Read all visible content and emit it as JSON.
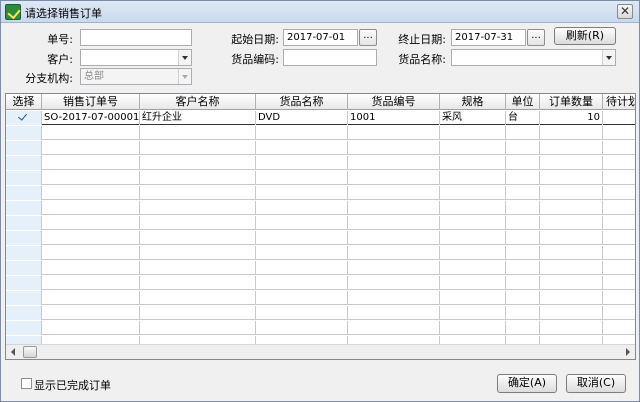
{
  "window": {
    "title": "请选择销售订单",
    "close_symbol": "✕"
  },
  "filters": {
    "order_no_label": "单号:",
    "order_no_value": "",
    "start_date_label": "起始日期:",
    "start_date_value": "2017-07-01",
    "end_date_label": "终止日期:",
    "end_date_value": "2017-07-31",
    "refresh_label": "刷新(R)",
    "customer_label": "客户:",
    "customer_value": "",
    "goods_code_label": "货品编码:",
    "goods_code_value": "",
    "goods_name_label": "货品名称:",
    "goods_name_value": "",
    "branch_label": "分支机构:",
    "branch_value": "总部",
    "dots": "..."
  },
  "grid": {
    "columns": [
      "选择",
      "销售订单号",
      "客户名称",
      "货品名称",
      "货品编号",
      "规格",
      "单位",
      "订单数量",
      "待计划"
    ],
    "rows": [
      {
        "selected": true,
        "order_no": "SO-2017-07-00001",
        "customer": "红升企业",
        "goods_name": "DVD",
        "goods_code": "1001",
        "spec": "采风",
        "unit": "台",
        "qty": "10",
        "pending": ""
      }
    ],
    "empty_row_count": 16
  },
  "footer": {
    "show_completed_label": "显示已完成订单",
    "ok_label": "确定(A)",
    "cancel_label": "取消(C)"
  },
  "icons": {
    "app": "app-check-icon",
    "close": "close-icon",
    "check": "check-icon",
    "dropdown": "chevron-down-icon"
  }
}
